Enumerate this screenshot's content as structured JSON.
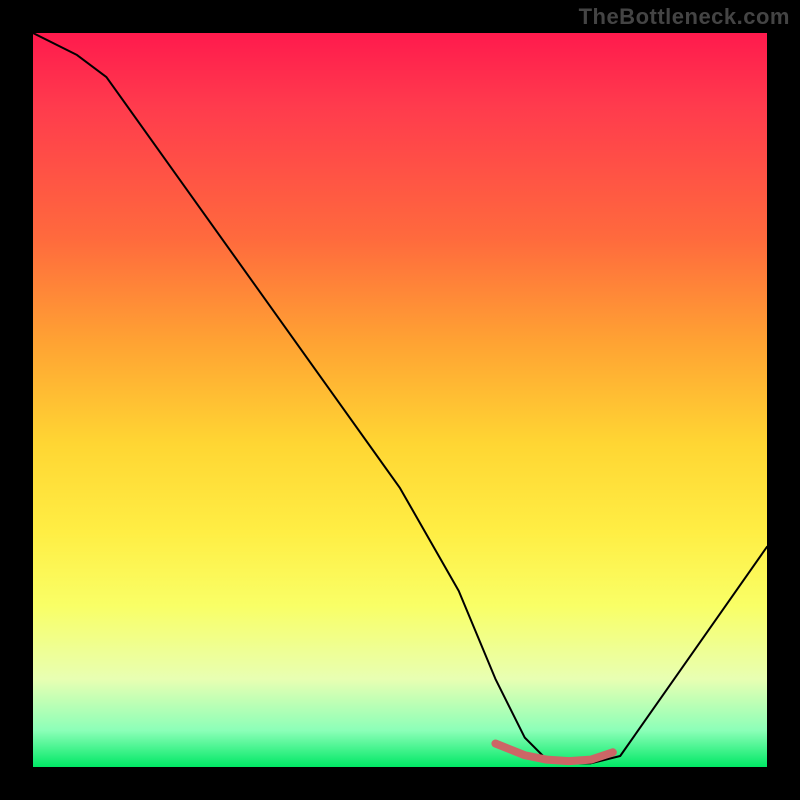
{
  "watermark": "TheBottleneck.com",
  "chart_data": {
    "type": "line",
    "title": "",
    "xlabel": "",
    "ylabel": "",
    "xlim": [
      0,
      100
    ],
    "ylim": [
      0,
      100
    ],
    "series": [
      {
        "name": "bottleneck-curve",
        "x": [
          0,
          6,
          10,
          20,
          30,
          40,
          50,
          58,
          63,
          67,
          70,
          73,
          76,
          80,
          100
        ],
        "values": [
          100,
          97,
          94,
          80,
          66,
          52,
          38,
          24,
          12,
          4,
          1,
          0.5,
          0.5,
          1.5,
          30
        ],
        "stroke": "#000000",
        "stroke_width": 2
      },
      {
        "name": "optimal-zone",
        "x": [
          63,
          67,
          70,
          73,
          76,
          79
        ],
        "values": [
          3.2,
          1.6,
          1.0,
          0.8,
          1.0,
          2.0
        ],
        "stroke": "#cc6666",
        "stroke_width": 8
      }
    ],
    "background_gradient": {
      "top": "#ff1a4d",
      "middle": "#ffee44",
      "bottom": "#00e865"
    }
  }
}
